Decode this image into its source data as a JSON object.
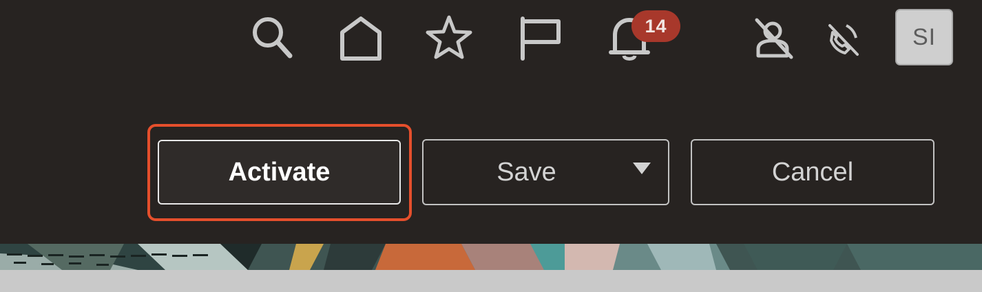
{
  "header": {
    "icons": [
      {
        "name": "search-icon"
      },
      {
        "name": "home-icon"
      },
      {
        "name": "favorites-star-icon"
      },
      {
        "name": "flag-icon"
      },
      {
        "name": "notifications-bell-icon"
      },
      {
        "name": "user-unavailable-icon"
      },
      {
        "name": "phone-muted-icon"
      }
    ],
    "notification_count": "14",
    "avatar_initials": "SI"
  },
  "actions": {
    "activate_label": "Activate",
    "save_label": "Save",
    "cancel_label": "Cancel"
  },
  "colors": {
    "background": "#272321",
    "badge": "#a8382b",
    "focus_ring": "#e54f2c",
    "avatar_bg": "#cfcfcf",
    "footer": "#c9c9c9"
  }
}
